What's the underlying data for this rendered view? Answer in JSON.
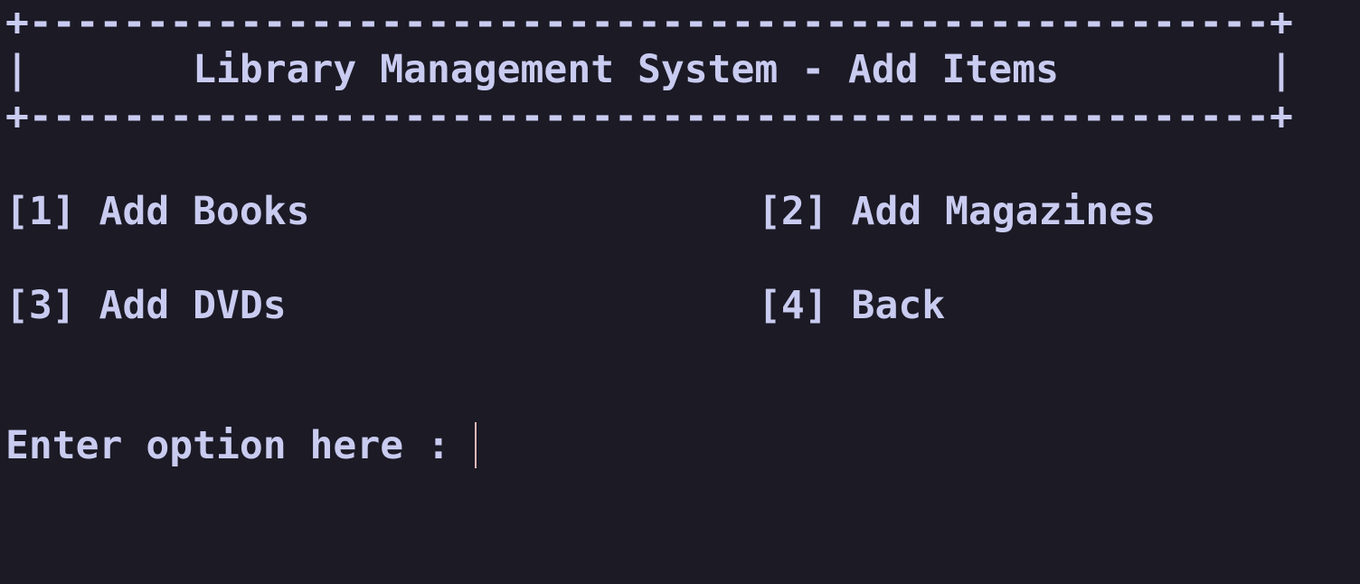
{
  "header": {
    "border_top": "+-----------------------------------------------------+",
    "title_line": "|       Library Management System - Add Items         |",
    "border_bottom": "+-----------------------------------------------------+"
  },
  "menu": {
    "options": [
      {
        "label": "[1] Add Books"
      },
      {
        "label": "[2] Add Magazines"
      },
      {
        "label": "[3] Add DVDs"
      },
      {
        "label": "[4] Back"
      }
    ]
  },
  "prompt": {
    "text": "Enter option here : ",
    "value": ""
  },
  "colors": {
    "background": "#1b1a25",
    "foreground": "#c9cbf0",
    "cursor": "#e6b7b7"
  }
}
